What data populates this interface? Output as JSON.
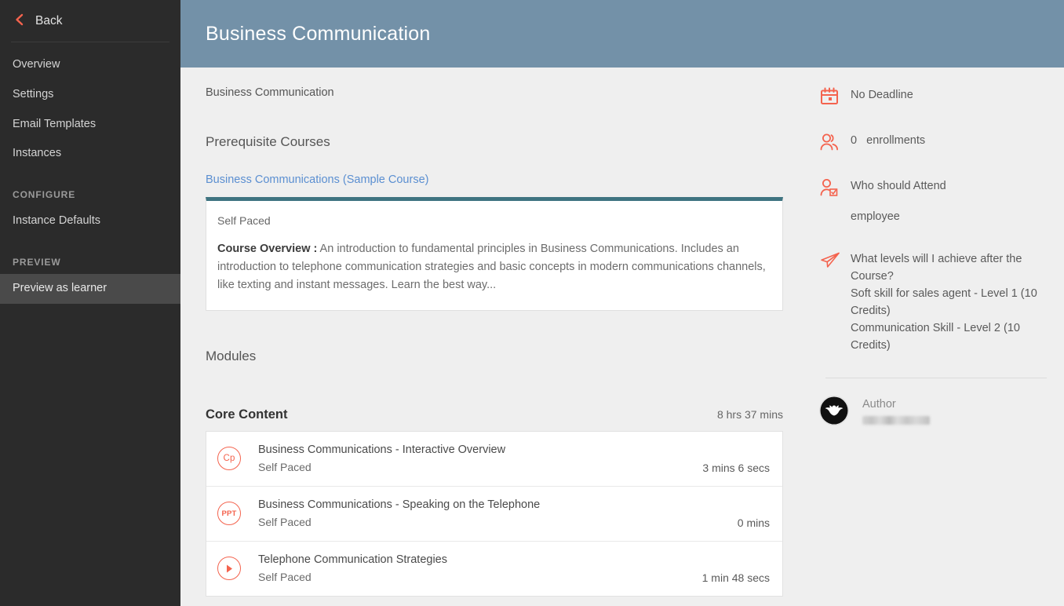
{
  "sidebar": {
    "back_label": "Back",
    "back_icon": "chevron-left-icon",
    "items": [
      {
        "label": "Overview",
        "active": false
      },
      {
        "label": "Settings",
        "active": false
      },
      {
        "label": "Email Templates",
        "active": false
      },
      {
        "label": "Instances",
        "active": false
      }
    ],
    "sections": [
      {
        "title": "CONFIGURE",
        "items": [
          {
            "label": "Instance Defaults",
            "active": false
          }
        ]
      },
      {
        "title": "PREVIEW",
        "items": [
          {
            "label": "Preview as learner",
            "active": true
          }
        ]
      }
    ]
  },
  "header": {
    "title": "Business Communication",
    "bg_color": "#7391a8"
  },
  "main": {
    "breadcrumb": "Business Communication",
    "prerequisite_heading": "Prerequisite Courses",
    "prerequisite_link": "Business Communications (Sample Course)",
    "prerequisite_card": {
      "mode": "Self Paced",
      "overview_label": "Course Overview :",
      "overview_text": " An introduction to fundamental principles in Business Communications. Includes an introduction to telephone communication strategies and basic concepts in modern communications channels, like texting and instant messages. Learn the best way...",
      "accent_color": "#3f7481"
    },
    "modules_heading": "Modules",
    "core_content": {
      "title": "Core Content",
      "duration": "8 hrs 37 mins"
    },
    "module_rows": [
      {
        "icon": "captivate-icon",
        "icon_text": "Cp",
        "title": "Business Communications - Interactive Overview",
        "mode": "Self Paced",
        "duration": "3 mins 6 secs"
      },
      {
        "icon": "powerpoint-icon",
        "icon_text": "PPT",
        "title": "Business Communications - Speaking on the Telephone",
        "mode": "Self Paced",
        "duration": "0 mins"
      },
      {
        "icon": "play-icon",
        "icon_text": "",
        "title": "Telephone Communication Strategies",
        "mode": "Self Paced",
        "duration": "1 min 48 secs"
      }
    ]
  },
  "right_panel": {
    "accent_color": "#f4634e",
    "deadline": {
      "icon": "calendar-icon",
      "text": "No Deadline"
    },
    "enrollments": {
      "icon": "users-icon",
      "count": "0",
      "label": "enrollments"
    },
    "audience": {
      "icon": "user-check-icon",
      "title": "Who should Attend",
      "value": "employee"
    },
    "levels": {
      "icon": "paper-plane-icon",
      "question": "What levels will I achieve after the Course?",
      "items": [
        "Soft skill for sales agent - Level 1 (10 Credits)",
        "Communication Skill - Level 2 (10 Credits)"
      ]
    },
    "author": {
      "label": "Author",
      "avatar_icon": "batman-avatar-icon",
      "name_redacted": ""
    }
  }
}
